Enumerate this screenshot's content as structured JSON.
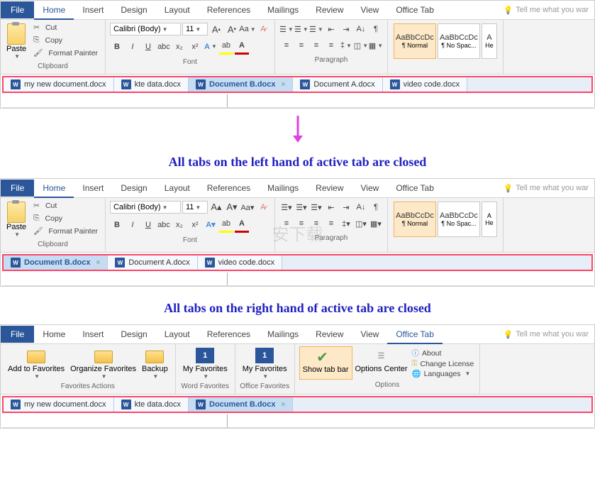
{
  "menu": {
    "file": "File",
    "home": "Home",
    "insert": "Insert",
    "design": "Design",
    "layout": "Layout",
    "references": "References",
    "mailings": "Mailings",
    "review": "Review",
    "view": "View",
    "office_tab": "Office Tab",
    "tell_me": "Tell me what you war"
  },
  "clipboard": {
    "paste": "Paste",
    "cut": "Cut",
    "copy": "Copy",
    "format_painter": "Format Painter",
    "label": "Clipboard"
  },
  "font": {
    "name": "Calibri (Body)",
    "size": "11",
    "label": "Font"
  },
  "font_btns": {
    "B": "B",
    "I": "I",
    "U": "U"
  },
  "paragraph": {
    "label": "Paragraph"
  },
  "styles": {
    "sample": "AaBbCcDc",
    "normal": "¶ Normal",
    "nospac": "¶ No Spac...",
    "heading": "He"
  },
  "tabs1": [
    "my new document.docx",
    "kte data.docx",
    "Document B.docx",
    "Document A.docx",
    "video code.docx"
  ],
  "active1": 2,
  "caption1": "All tabs on the left hand of active tab are closed",
  "tabs2": [
    "Document B.docx",
    "Document A.docx",
    "video code.docx"
  ],
  "active2": 0,
  "caption2": "All tabs on the right hand of active tab are closed",
  "tabs3": [
    "my new document.docx",
    "kte data.docx",
    "Document B.docx"
  ],
  "active3": 2,
  "office_tab": {
    "add_fav": "Add to Favorites",
    "org_fav": "Organize Favorites",
    "backup": "Backup",
    "my_fav": "My Favorites",
    "my_fav2": "My Favorites",
    "show_tab": "Show tab bar",
    "opt_center": "Options Center",
    "about": "About",
    "license": "Change License",
    "lang": "Languages",
    "fav_actions": "Favorites Actions",
    "word_fav": "Word Favorites",
    "office_fav": "Office Favorites",
    "options": "Options"
  }
}
